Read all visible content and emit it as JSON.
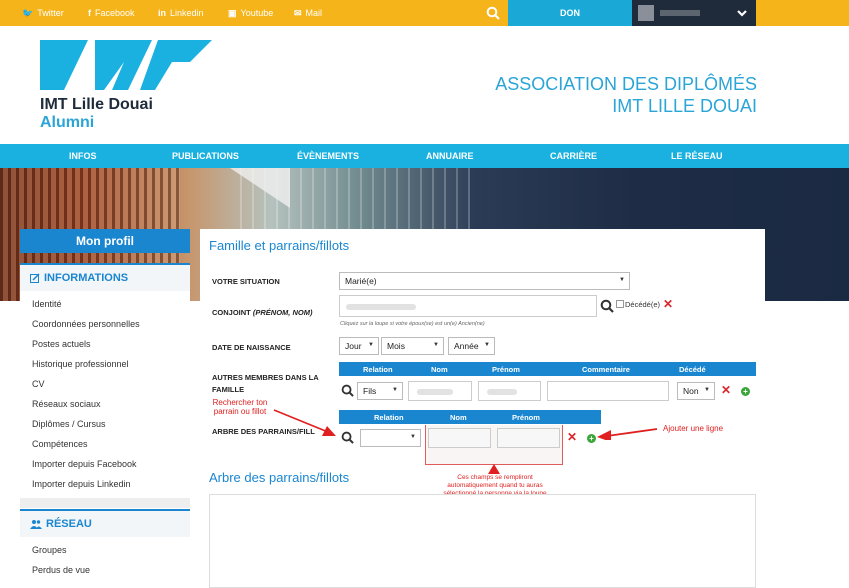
{
  "topbar": {
    "social": [
      {
        "label": "Twitter",
        "icon": "twitter-icon"
      },
      {
        "label": "Facebook",
        "icon": "facebook-icon"
      },
      {
        "label": "Linkedin",
        "icon": "linkedin-icon"
      },
      {
        "label": "Youtube",
        "icon": "youtube-icon"
      },
      {
        "label": "Mail",
        "icon": "mail-icon"
      }
    ],
    "don_label": "DON",
    "colors": {
      "bar": "#f5b41a",
      "don": "#1aa9d6",
      "account": "#1f2a3a"
    }
  },
  "header": {
    "logo_line1": "IMT Lille Douai",
    "logo_line2": "Alumni",
    "assoc_line1": "ASSOCIATION DES DIPLÔMÉS",
    "assoc_line2": "IMT LILLE DOUAI"
  },
  "nav": {
    "items": [
      "INFOS",
      "PUBLICATIONS",
      "ÉVÈNEMENTS",
      "ANNUAIRE",
      "CARRIÈRE",
      "LE RÉSEAU"
    ]
  },
  "sidebar": {
    "profile_button": "Mon profil",
    "informations_title": "INFORMATIONS",
    "informations_items": [
      "Identité",
      "Coordonnées personnelles",
      "Postes actuels",
      "Historique professionnel",
      "CV",
      "Réseaux sociaux",
      "Diplômes / Cursus",
      "Compétences",
      "Importer depuis Facebook",
      "Importer depuis Linkedin"
    ],
    "reseau_title": "RÉSEAU",
    "reseau_items": [
      "Groupes",
      "Perdus de vue"
    ]
  },
  "form": {
    "title": "Famille et parrains/fillots",
    "situation_label": "VOTRE SITUATION",
    "situation_value": "Marié(e)",
    "conjoint_label_bold": "CONJOINT",
    "conjoint_label_ital": "(PRÉNOM, NOM)",
    "decede_label": "Décédé(e)",
    "conjoint_hint": "Cliquez sur la loupe si votre époux(se) est un(e) Ancien(ne)",
    "birth_label": "DATE DE NAISSANCE",
    "birth_day": "Jour",
    "birth_month": "Mois",
    "birth_year": "Année",
    "family_label_l1": "AUTRES MEMBRES DANS LA",
    "family_label_l2": "FAMILLE",
    "family_headers": [
      "Relation",
      "Nom",
      "Prénom",
      "Commentaire",
      "Décédé"
    ],
    "family_relation_value": "Fils",
    "family_decede_value": "Non",
    "tree_label": "ARBRE DES PARRAINS/FILL",
    "tree_headers": [
      "Relation",
      "Nom",
      "Prénom"
    ],
    "tree_title": "Arbre des parrains/fillots"
  },
  "annotations": {
    "search_note_l1": "Rechercher ton",
    "search_note_l2": "parrain ou fillot",
    "add_note": "Ajouter une ligne",
    "fields_note_l1": "Ces champs se rempliront",
    "fields_note_l2": "automatiquement quand tu auras",
    "fields_note_l3": "sélectionné la personne via la loupe"
  }
}
